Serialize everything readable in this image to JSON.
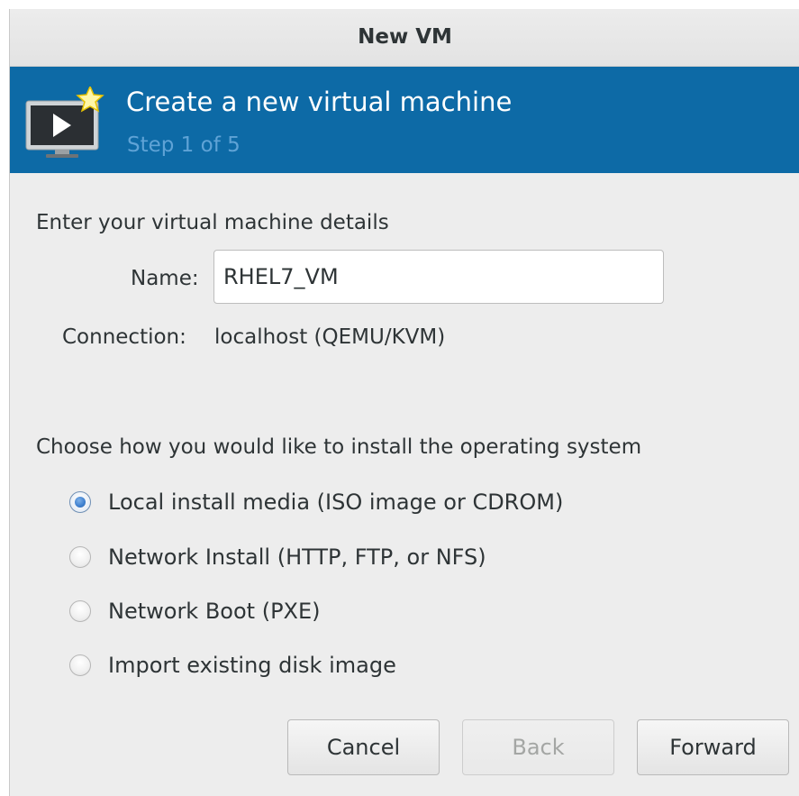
{
  "window": {
    "title": "New VM"
  },
  "header": {
    "title": "Create a new virtual machine",
    "step": "Step 1 of 5",
    "icon": "new-vm-monitor-icon"
  },
  "details": {
    "section_label": "Enter your virtual machine details",
    "name_label": "Name:",
    "name_value": "RHEL7_VM",
    "connection_label": "Connection:",
    "connection_value": "localhost (QEMU/KVM)"
  },
  "install": {
    "section_label": "Choose how you would like to install the operating system",
    "options": [
      {
        "label": "Local install media (ISO image or CDROM)",
        "selected": true
      },
      {
        "label": "Network Install (HTTP, FTP, or NFS)",
        "selected": false
      },
      {
        "label": "Network Boot (PXE)",
        "selected": false
      },
      {
        "label": "Import existing disk image",
        "selected": false
      }
    ]
  },
  "buttons": {
    "cancel": "Cancel",
    "back": "Back",
    "back_enabled": false,
    "forward": "Forward"
  },
  "colors": {
    "banner": "#0d6aa6",
    "banner_step_text": "#5fa3d6",
    "window_bg": "#ededed"
  }
}
